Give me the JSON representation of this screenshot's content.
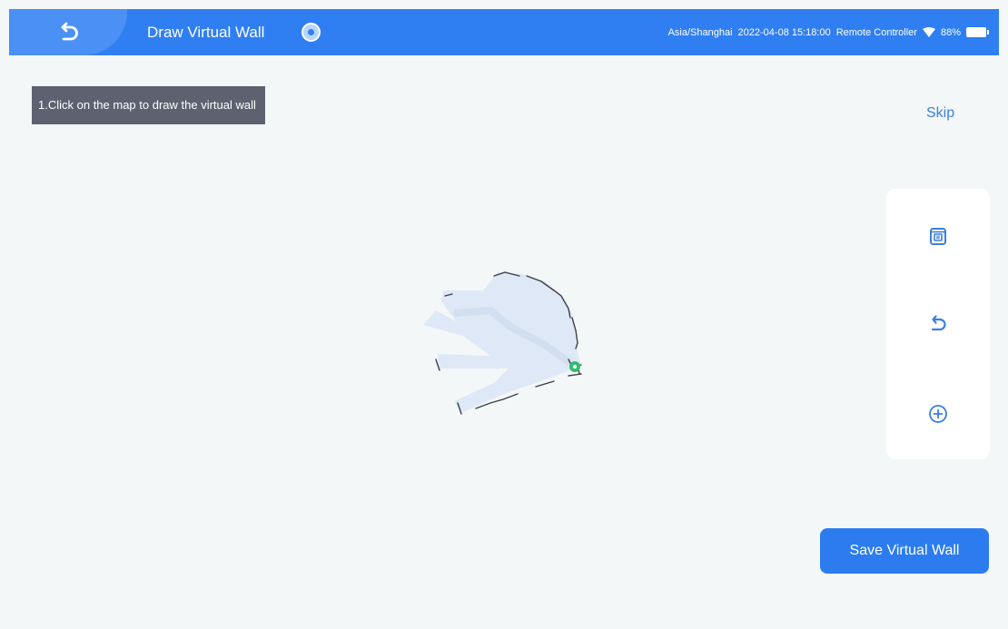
{
  "header": {
    "title": "Draw Virtual Wall",
    "timezone": "Asia/Shanghai",
    "datetime": "2022-04-08 15:18:00",
    "mode": "Remote Controller",
    "battery": "88%",
    "accent_color": "#2f7ff2"
  },
  "hint": {
    "text": "1.Click on the map to draw the virtual wall"
  },
  "skip_label": "Skip",
  "toolbar": {
    "items": [
      {
        "icon": "trash-icon",
        "action": "delete"
      },
      {
        "icon": "undo-icon",
        "action": "undo"
      },
      {
        "icon": "add-circle-icon",
        "action": "add"
      }
    ]
  },
  "save_label": "Save Virtual Wall",
  "icons": {
    "back": "back-arrow-icon",
    "info": "info-icon",
    "wifi": "wifi-icon",
    "battery": "battery-icon",
    "robot": "robot-position-icon"
  }
}
